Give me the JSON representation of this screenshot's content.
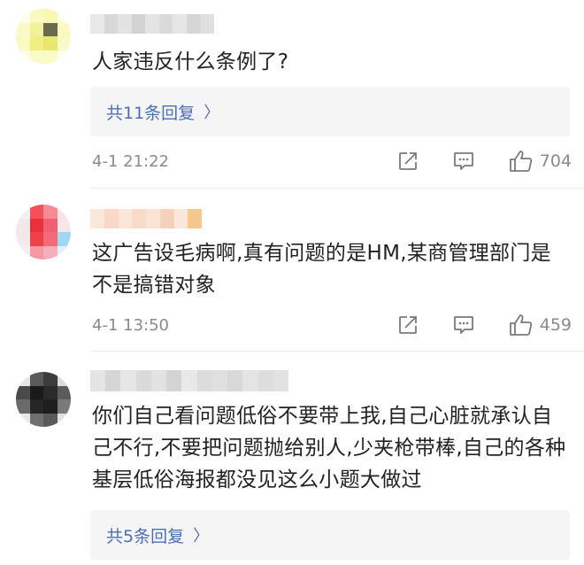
{
  "comments": [
    {
      "text": "人家违反什么条例了?",
      "replies_label": "共11条回复",
      "time": "4-1 21:22",
      "likes": "704",
      "avatar_colors": [
        "#fdfde8",
        "#fafac0",
        "#f8f8b0",
        "#fdfde8",
        "#fafac8",
        "#f3f09a",
        "#6a6a50",
        "#fafac0",
        "#fafac0",
        "#f0f080",
        "#e8e870",
        "#fafac8",
        "#fdfde8",
        "#fafac8",
        "#fafac8",
        "#fdfde8"
      ],
      "name_blur_colors": [
        "#e8e8e8",
        "#d8d8d8",
        "#e2e2e2",
        "#d2d2d2",
        "#e4e4e4",
        "#dadada",
        "#e6e6e6",
        "#d6d6d6",
        "#e0e0e0"
      ]
    },
    {
      "text": "这广告设毛病啊,真有问题的是HM,某商管理部门是不是搞错对象",
      "time": "4-1 13:50",
      "likes": "459",
      "avatar_colors": [
        "#f5f0f0",
        "#f2505a",
        "#f58a95",
        "#f7e3e6",
        "#f5e8ea",
        "#e8303a",
        "#f06070",
        "#f7e6e8",
        "#f5e8ea",
        "#f04048",
        "#f36a78",
        "#9fd8f2",
        "#f7eeee",
        "#f59aa5",
        "#f3b0b8",
        "#dff1fa"
      ],
      "name_blur_colors": [
        "#fbe8dc",
        "#f8d8c6",
        "#fbe6da",
        "#f8dcc8",
        "#fae2d4",
        "#f6d2bc",
        "#fbe8dc",
        "#f5c98c"
      ]
    },
    {
      "text": "你们自己看问题低俗不要带上我,自己心脏就承认自己不行,不要把问题抛给别人,少夹枪带棒,自己的各种基层低俗海报都没见这么小题大做过",
      "replies_label": "共5条回复",
      "avatar_colors": [
        "#e6e6e6",
        "#5a5a5a",
        "#3c3c3c",
        "#dcdcdc",
        "#4a4a4a",
        "#1a1a1a",
        "#2a2a2a",
        "#5c5c5c",
        "#6a6a6a",
        "#262626",
        "#1e1e1e",
        "#7a7a7a",
        "#e8e8e8",
        "#707070",
        "#5a5a5a",
        "#e0e0e0"
      ],
      "name_blur_colors": [
        "#e4e4e4",
        "#d6d6d6",
        "#e6e6e6",
        "#dadada",
        "#e2e2e2",
        "#d4d4d4",
        "#e8e8e8",
        "#dcdcdc",
        "#e0e0e0",
        "#d8d8d8",
        "#e4e4e4",
        "#dedede",
        "#e2e2e2"
      ]
    }
  ],
  "icons": {
    "share": "share-icon",
    "comment": "comment-icon",
    "like": "thumbs-up-icon",
    "chevron": "chevron-right-icon"
  },
  "colors": {
    "link": "#4c6fb4",
    "meta": "#8a8a8a",
    "reply_bg": "#f5f5f5"
  },
  "chevron_glyph": "〉"
}
